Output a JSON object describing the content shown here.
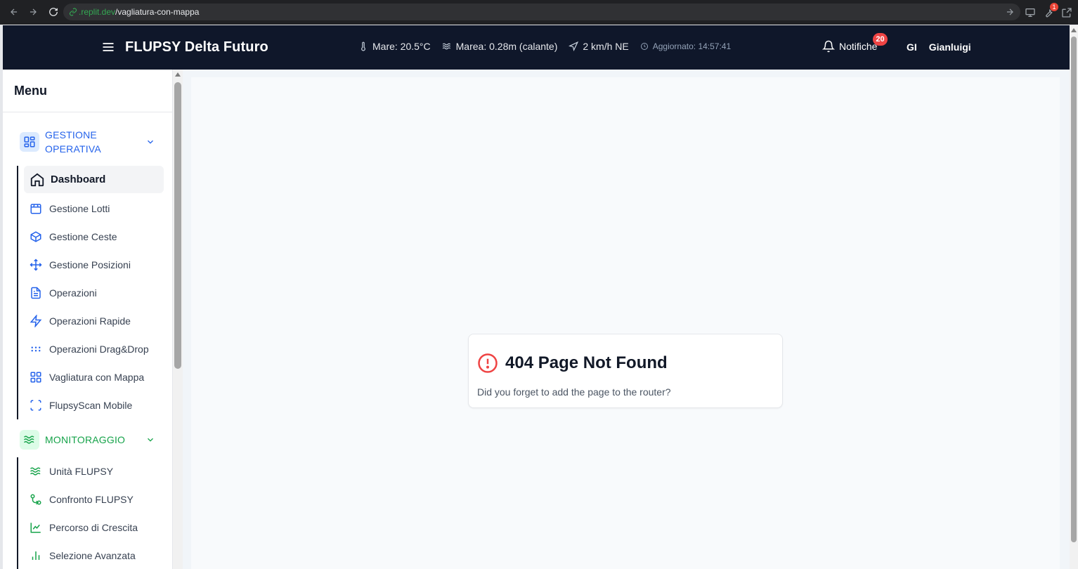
{
  "browser": {
    "url_host": ".replit.dev",
    "url_path": "/vagliatura-con-mappa",
    "extension_badge": "1"
  },
  "header": {
    "title": "FLUPSY Delta Futuro",
    "weather": {
      "sea": "Mare: 20.5°C",
      "tide": "Marea: 0.28m (calante)",
      "wind": "2 km/h NE",
      "updated": "Aggiornato: 14:57:41"
    },
    "notifications_label": "Notifiche",
    "notifications_count": "20",
    "user_initials": "GI",
    "user_name": "Gianluigi"
  },
  "sidebar": {
    "title": "Menu",
    "sections": [
      {
        "label_line1": "GESTIONE",
        "label_line2": "OPERATIVA",
        "color": "#2563eb",
        "items": [
          {
            "label": "Dashboard",
            "icon": "home-icon",
            "active": true
          },
          {
            "label": "Gestione Lotti",
            "icon": "package-icon"
          },
          {
            "label": "Gestione Ceste",
            "icon": "box-icon"
          },
          {
            "label": "Gestione Posizioni",
            "icon": "move-icon"
          },
          {
            "label": "Operazioni",
            "icon": "file-text-icon"
          },
          {
            "label": "Operazioni Rapide",
            "icon": "zap-icon"
          },
          {
            "label": "Operazioni Drag&Drop",
            "icon": "grip-icon"
          },
          {
            "label": "Vagliatura con Mappa",
            "icon": "layout-grid-icon"
          },
          {
            "label": "FlupsyScan Mobile",
            "icon": "scan-icon"
          }
        ]
      },
      {
        "label_line1": "MONITORAGGIO",
        "color": "#16a34a",
        "items": [
          {
            "label": "Unità FLUPSY",
            "icon": "waves-icon"
          },
          {
            "label": "Confronto FLUPSY",
            "icon": "git-compare-icon"
          },
          {
            "label": "Percorso di Crescita",
            "icon": "line-chart-icon"
          },
          {
            "label": "Selezione Avanzata",
            "icon": "bar-chart-icon"
          }
        ]
      }
    ]
  },
  "main": {
    "error_title": "404 Page Not Found",
    "error_message": "Did you forget to add the page to the router?"
  }
}
